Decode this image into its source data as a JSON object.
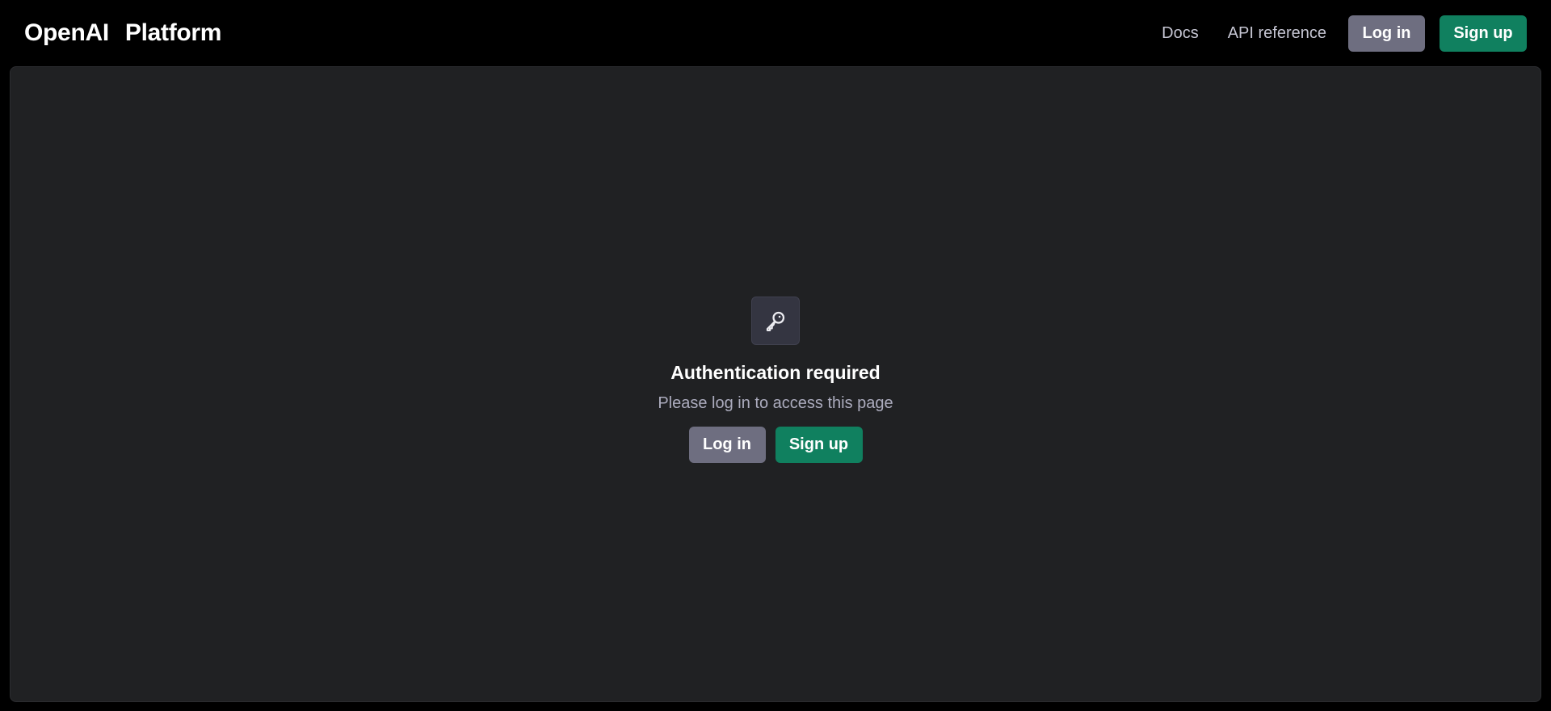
{
  "header": {
    "brand_primary": "OpenAI",
    "brand_secondary": "Platform",
    "nav": {
      "docs": "Docs",
      "api_reference": "API reference"
    },
    "login_label": "Log in",
    "signup_label": "Sign up"
  },
  "auth": {
    "icon": "key-icon",
    "title": "Authentication required",
    "subtitle": "Please log in to access this page",
    "login_label": "Log in",
    "signup_label": "Sign up"
  },
  "colors": {
    "background": "#000000",
    "panel": "#202123",
    "login_button": "#6e6e80",
    "signup_button": "#10805f"
  }
}
